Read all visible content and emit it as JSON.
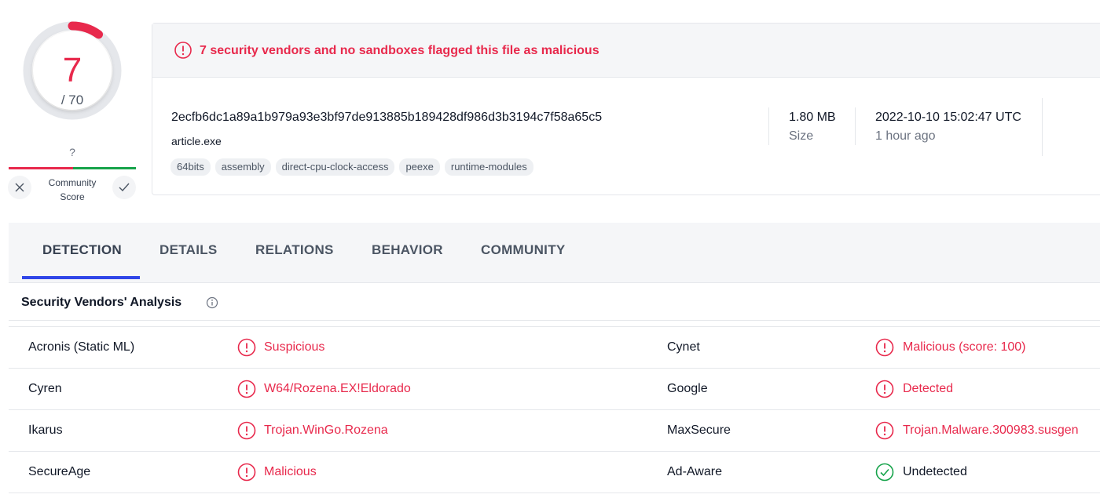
{
  "score": {
    "detections": "7",
    "total": "/ 70",
    "detected_fraction": 0.1
  },
  "community": {
    "question": "?",
    "label_line1": "Community",
    "label_line2": "Score"
  },
  "banner": {
    "text": "7 security vendors and no sandboxes flagged this file as malicious"
  },
  "file": {
    "hash": "2ecfb6dc1a89a1b979a93e3bf97de913885b189428df986d3b3194c7f58a65c5",
    "name": "article.exe",
    "tags": [
      "64bits",
      "assembly",
      "direct-cpu-clock-access",
      "peexe",
      "runtime-modules"
    ],
    "size": "1.80 MB",
    "size_label": "Size",
    "date": "2022-10-10 15:02:47 UTC",
    "date_relative": "1 hour ago"
  },
  "tabs": [
    "DETECTION",
    "DETAILS",
    "RELATIONS",
    "BEHAVIOR",
    "COMMUNITY"
  ],
  "active_tab": "DETECTION",
  "section": {
    "title": "Security Vendors' Analysis"
  },
  "vendors": [
    [
      {
        "name": "Acronis (Static ML)",
        "result": "Suspicious",
        "status": "malicious"
      },
      {
        "name": "Cynet",
        "result": "Malicious (score: 100)",
        "status": "malicious"
      }
    ],
    [
      {
        "name": "Cyren",
        "result": "W64/Rozena.EX!Eldorado",
        "status": "malicious"
      },
      {
        "name": "Google",
        "result": "Detected",
        "status": "malicious"
      }
    ],
    [
      {
        "name": "Ikarus",
        "result": "Trojan.WinGo.Rozena",
        "status": "malicious"
      },
      {
        "name": "MaxSecure",
        "result": "Trojan.Malware.300983.susgen",
        "status": "malicious"
      }
    ],
    [
      {
        "name": "SecureAge",
        "result": "Malicious",
        "status": "malicious"
      },
      {
        "name": "Ad-Aware",
        "result": "Undetected",
        "status": "undetected"
      }
    ]
  ],
  "colors": {
    "malicious": "#e8294c",
    "undetected": "#16a34a",
    "accent": "#3046e8"
  },
  "icons": {
    "alert": "alert-circle-icon",
    "ok": "check-circle-icon",
    "info": "info-icon",
    "close": "close-icon",
    "check": "check-icon"
  }
}
